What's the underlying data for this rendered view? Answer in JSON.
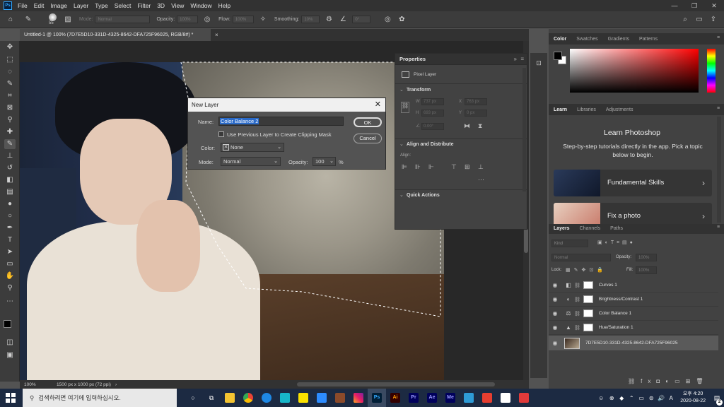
{
  "menubar": {
    "app_icon": "Ps",
    "items": [
      "File",
      "Edit",
      "Image",
      "Layer",
      "Type",
      "Select",
      "Filter",
      "3D",
      "View",
      "Window",
      "Help"
    ],
    "window_controls": [
      "—",
      "❐",
      "✕"
    ]
  },
  "options": {
    "brush_size": "55",
    "mode_label": "Mode:",
    "mode_value": "Normal",
    "opacity_label": "Opacity:",
    "opacity_value": "100%",
    "flow_label": "Flow:",
    "flow_value": "100%",
    "smoothing_label": "Smoothing:",
    "smoothing_value": "10%",
    "angle_value": "0°"
  },
  "document": {
    "tab_title": "Untitled-1 @ 100% (7D7E5D10-331D-4325-8642-DFA725F96025, RGB/8#) *",
    "zoom": "100%",
    "doc_info": "1500 px x 1000 px (72 ppi)"
  },
  "properties": {
    "title": "Properties",
    "kind": "Pixel Layer",
    "transform_section": "Transform",
    "w_label": "W",
    "w_value": "737 px",
    "h_label": "H",
    "h_value": "693 px",
    "x_label": "X",
    "x_value": "763 px",
    "y_label": "Y",
    "y_value": "0 px",
    "angle_value": "0.00°",
    "align_section": "Align and Distribute",
    "align_label": "Align:",
    "quick_actions": "Quick Actions"
  },
  "color_panel": {
    "tabs": [
      "Color",
      "Swatches",
      "Gradients",
      "Patterns"
    ]
  },
  "learn_panel": {
    "tabs": [
      "Learn",
      "Libraries",
      "Adjustments"
    ],
    "heading": "Learn Photoshop",
    "subtitle": "Step-by-step tutorials directly in the app. Pick a topic below to begin.",
    "cards": [
      "Fundamental Skills",
      "Fix a photo"
    ]
  },
  "layers_panel": {
    "tabs": [
      "Layers",
      "Channels",
      "Paths"
    ],
    "kind_filter": "Kind",
    "blend_mode": "Normal",
    "opacity_label": "Opacity:",
    "opacity_value": "100%",
    "lock_label": "Lock:",
    "fill_label": "Fill:",
    "fill_value": "100%",
    "layers": [
      {
        "name": "Curves 1"
      },
      {
        "name": "Brightness/Contrast 1"
      },
      {
        "name": "Color Balance 1"
      },
      {
        "name": "Hue/Saturation 1"
      },
      {
        "name": "7D7E5D10-331D-4325-8642-DFA725F96025"
      }
    ],
    "footer_icons": [
      "link-icon",
      "fx",
      "mask-icon",
      "adjustment-icon",
      "folder-icon",
      "new-layer-icon",
      "trash-icon"
    ]
  },
  "dialog": {
    "title": "New Layer",
    "name_label": "Name:",
    "name_value": "Color Balance 2",
    "clipping_label": "Use Previous Layer to Create Clipping Mask",
    "color_label": "Color:",
    "color_value": "None",
    "mode_label": "Mode:",
    "mode_value": "Normal",
    "opacity_label": "Opacity:",
    "opacity_value": "100",
    "percent": "%",
    "ok_label": "OK",
    "cancel_label": "Cancel"
  },
  "taskbar": {
    "search_placeholder": "검색하려면 여기에 입력하십시오.",
    "apps": [
      "Ps",
      "Ai",
      "Pr",
      "Ae",
      "Me"
    ],
    "time": "오후 4:20",
    "date": "2020-08-22",
    "notification_count": "2"
  }
}
